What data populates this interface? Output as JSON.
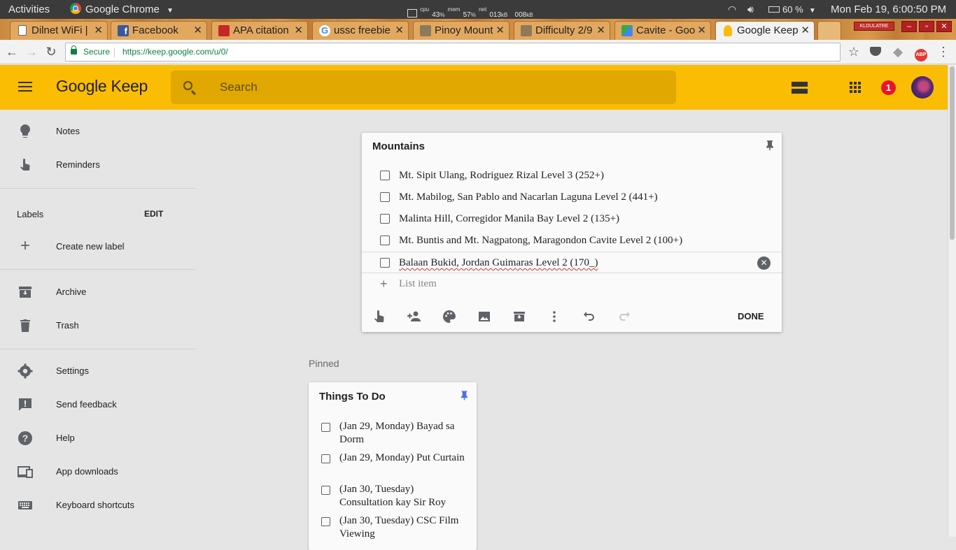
{
  "topbar": {
    "activities": "Activities",
    "app_name": "Google Chrome",
    "cpu_label": "cpu",
    "cpu_value": "43",
    "mem_label": "mem",
    "mem_value": "57",
    "net_label": "net",
    "net_down": "013",
    "net_up": "008",
    "battery": "60 %",
    "datetime": "Mon Feb 19,  6:00:50 PM"
  },
  "tabs": [
    {
      "title": "Dilnet WiFi |"
    },
    {
      "title": "Facebook"
    },
    {
      "title": "APA citation"
    },
    {
      "title": "ussc freebie"
    },
    {
      "title": "Pinoy Mount"
    },
    {
      "title": "Difficulty 2/9"
    },
    {
      "title": "Cavite - Goo"
    },
    {
      "title": "Google Keep"
    }
  ],
  "window": {
    "profile_badge": "KLDULATRE"
  },
  "address": {
    "secure": "Secure",
    "url": "https://keep.google.com/u/0/"
  },
  "keep": {
    "logo_google": "Google",
    "logo_keep": "Keep",
    "search_placeholder": "Search",
    "notification_count": "1"
  },
  "sidebar": {
    "notes": "Notes",
    "reminders": "Reminders",
    "labels": "Labels",
    "edit": "EDIT",
    "create_label": "Create new label",
    "archive": "Archive",
    "trash": "Trash",
    "settings": "Settings",
    "feedback": "Send feedback",
    "help": "Help",
    "downloads": "App downloads",
    "shortcuts": "Keyboard shortcuts"
  },
  "editor": {
    "title": "Mountains",
    "items": [
      "Mt. Sipit Ulang, Rodriguez Rizal Level 3 (252+)",
      "Mt. Mabilog, San Pablo and Nacarlan Laguna Level 2 (441+)",
      "Malinta Hill, Corregidor Manila Bay Level 2 (135+)",
      "Mt. Buntis and Mt. Nagpatong, Maragondon Cavite Level 2 (100+)",
      "Balaan Bukid, Jordan Guimaras Level 2 (170_)"
    ],
    "add_item": "List item",
    "done": "DONE"
  },
  "pinned": {
    "section_label": "Pinned",
    "card_title": "Things To Do",
    "items": [
      "(Jan 29, Monday) Bayad sa Dorm",
      "(Jan 29, Monday) Put Curtain",
      "(Jan 30, Tuesday) Consultation kay Sir Roy",
      "(Jan 30, Tuesday) CSC Film Viewing"
    ]
  },
  "colors": {
    "keep_yellow": "#fbbc04",
    "pin_blue": "#4a6cf7",
    "badge_red": "#e8142a"
  }
}
